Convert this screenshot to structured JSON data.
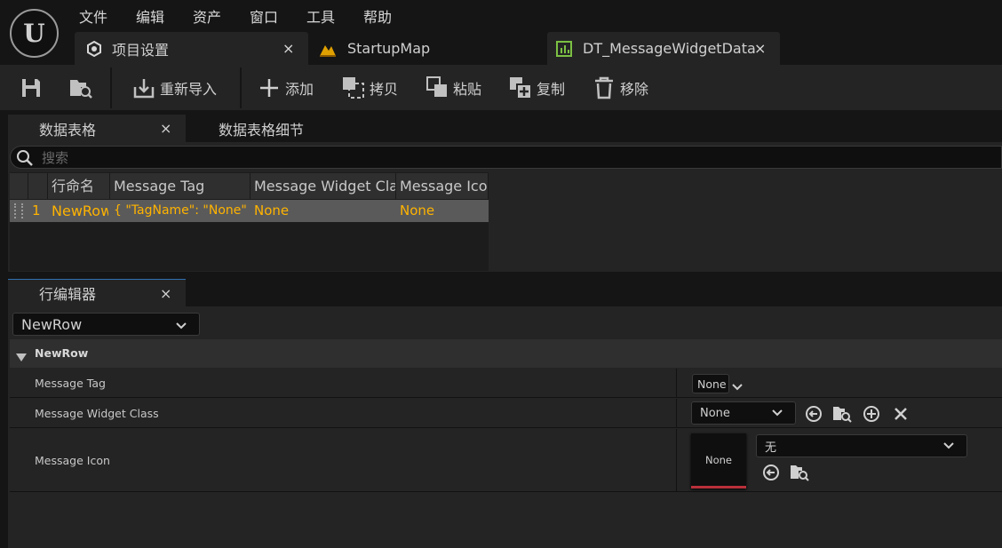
{
  "menu": [
    "文件",
    "编辑",
    "资产",
    "窗口",
    "工具",
    "帮助"
  ],
  "tabs": [
    {
      "label": "项目设置",
      "close": "×"
    },
    {
      "label": "StartupMap"
    },
    {
      "label": "DT_MessageWidgetData",
      "close": "×"
    }
  ],
  "toolbar": {
    "reimport": "重新导入",
    "add": "添加",
    "copy": "拷贝",
    "paste": "粘贴",
    "duplicate": "复制",
    "remove": "移除"
  },
  "datatable_panel": {
    "tab_label": "数据表格",
    "tab_close": "×",
    "details_tab_label": "数据表格细节",
    "search_placeholder": "搜索",
    "columns": [
      "行命名",
      "Message Tag",
      "Message Widget Class",
      "Message Icon"
    ],
    "rows": [
      {
        "index": "1",
        "name": "NewRow",
        "tag": "{ \"TagName\": \"None\" }",
        "widget_class": "None",
        "icon": "None"
      }
    ]
  },
  "row_editor": {
    "tab_label": "行编辑器",
    "tab_close": "×",
    "row_select": "NewRow",
    "section_title": "NewRow",
    "properties": {
      "message_tag": {
        "label": "Message Tag",
        "value": "None"
      },
      "message_widget_class": {
        "label": "Message Widget Class",
        "value": "None"
      },
      "message_icon": {
        "label": "Message Icon",
        "thumbnail": "None",
        "value": "无"
      }
    }
  },
  "colors": {
    "accent_row_text": "#ffb300",
    "background": "#151515",
    "panel": "#242424"
  }
}
